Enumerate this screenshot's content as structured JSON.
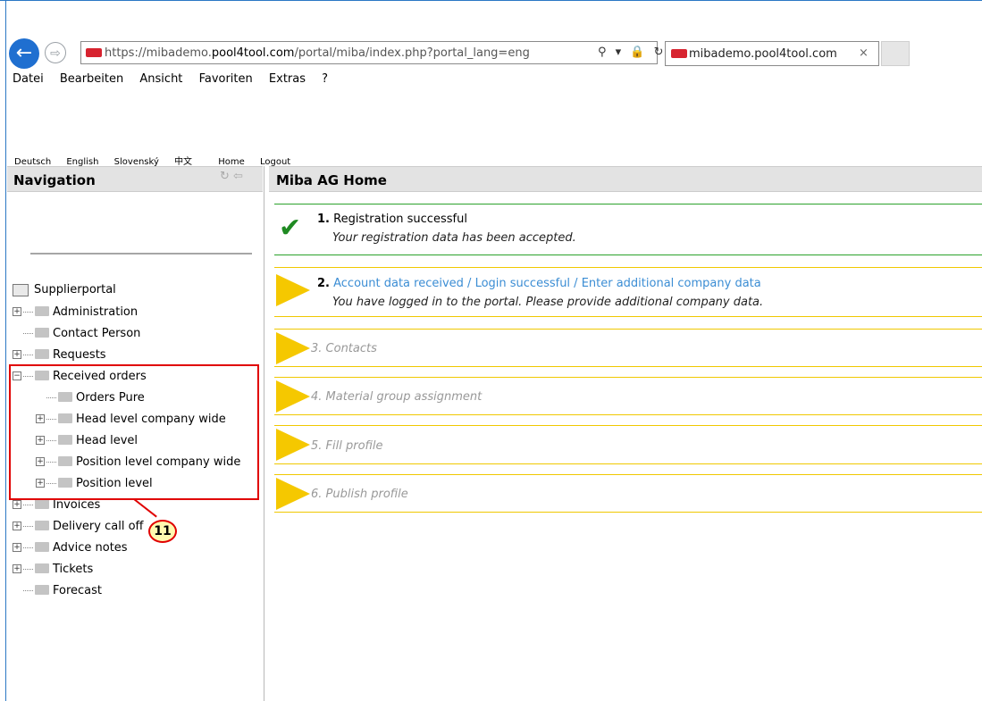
{
  "browser": {
    "url_prefix": "https://mibademo.",
    "url_domain": "pool4tool.com",
    "url_suffix": "/portal/miba/index.php?portal_lang=eng",
    "address_icons": "⚲ ▾ 🔒 ↻",
    "tab_title": "mibademo.pool4tool.com",
    "tab_close": "×",
    "menu": [
      "Datei",
      "Bearbeiten",
      "Ansicht",
      "Favoriten",
      "Extras",
      "?"
    ]
  },
  "portal_links": [
    "Deutsch",
    "English",
    "Slovenský",
    "中文",
    "Home",
    "Logout"
  ],
  "navigation": {
    "title": "Navigation",
    "root": "Supplierportal",
    "items": [
      {
        "label": "Administration",
        "expander": "+"
      },
      {
        "label": "Contact Person",
        "expander": ""
      },
      {
        "label": "Requests",
        "expander": "+"
      },
      {
        "label": "Received orders",
        "expander": "−"
      },
      {
        "label": "Orders Pure",
        "expander": ""
      },
      {
        "label": "Head level company wide",
        "expander": "+"
      },
      {
        "label": "Head level",
        "expander": "+"
      },
      {
        "label": "Position level company wide",
        "expander": "+"
      },
      {
        "label": "Position level",
        "expander": "+"
      },
      {
        "label": "Invoices",
        "expander": "+"
      },
      {
        "label": "Delivery call off",
        "expander": "+"
      },
      {
        "label": "Advice notes",
        "expander": "+"
      },
      {
        "label": "Tickets",
        "expander": "+"
      },
      {
        "label": "Forecast",
        "expander": ""
      }
    ]
  },
  "callout": "11",
  "main": {
    "title": "Miba AG Home",
    "steps": [
      {
        "num": "1.",
        "title": "Registration successful",
        "desc": "Your registration data has been accepted."
      },
      {
        "num": "2.",
        "title": "Account data received / Login successful / Enter additional company data",
        "desc": "You have logged in to the portal. Please provide additional company data."
      },
      {
        "title": "3. Contacts"
      },
      {
        "title": "4. Material group assignment"
      },
      {
        "title": "5. Fill profile"
      },
      {
        "title": "6. Publish profile"
      }
    ]
  },
  "colors": {
    "accent": "#2b78c5",
    "green": "#2ca22c",
    "yellow": "#f5c800",
    "highlight": "#e00000",
    "link": "#3b8dd4"
  }
}
